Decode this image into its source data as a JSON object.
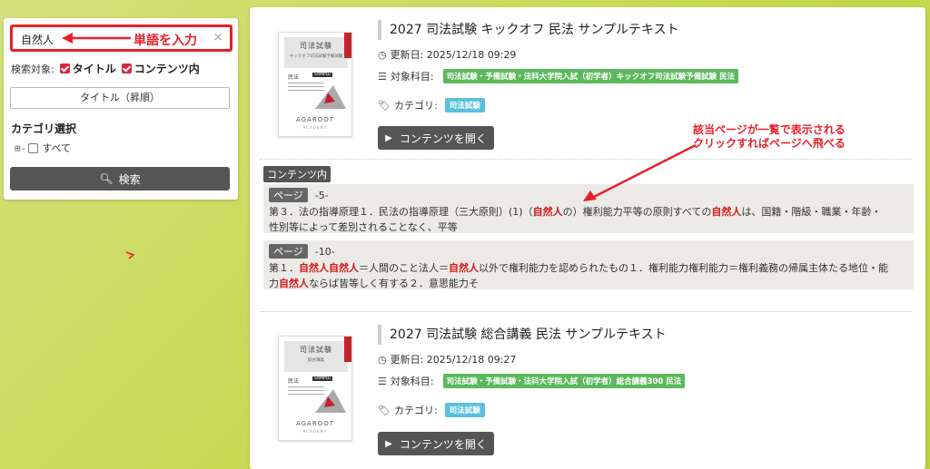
{
  "search": {
    "value": "自然人",
    "clear_icon": "×",
    "annotation": "単語を入力"
  },
  "filters": {
    "target_label": "検索対象:",
    "title_option": "タイトル",
    "contents_option": "コンテンツ内",
    "sort_value": "タイトル（昇順）",
    "category_title": "カテゴリ選択",
    "category_all": "すべて",
    "search_button": "検索"
  },
  "annotation_right": {
    "line1": "該当ページが一覧で表示される",
    "line2": "クリックすればページへ飛べる"
  },
  "items": [
    {
      "title": "2027 司法試験 キックオフ 民法 サンプルテキスト",
      "updated": "更新日: 2025/12/18 09:29",
      "subject_label": "対象科目:",
      "subject_tag": "司法試験・予備試験・法科大学院入試（初学者）キックオフ司法試験予備試験 民法",
      "category_label": "カテゴリ:",
      "category_tag": "司法試験",
      "open_button": "コンテンツを開く",
      "thumb": {
        "title": "司法試験",
        "subtitle": "キックオフ司法試験予備試験",
        "subject": "民法",
        "sample": "SAMPLE",
        "brand": "AGAROOT",
        "brand_sub": "ACADEMY"
      }
    },
    {
      "title": "2027 司法試験 総合講義 民法 サンプルテキスト",
      "updated": "更新日: 2025/12/18 09:27",
      "subject_label": "対象科目:",
      "subject_tag": "司法試験・予備試験・法科大学院入試（初学者）総合講義300 民法",
      "category_label": "カテゴリ:",
      "category_tag": "司法試験",
      "open_button": "コンテンツを開く",
      "thumb": {
        "title": "司法試験",
        "subtitle": "総合講義",
        "subject": "民法",
        "sample": "SAMPLE",
        "brand": "AGAROOT",
        "brand_sub": "ACADEMY"
      }
    }
  ],
  "contents_section": {
    "label": "コンテンツ内",
    "hits": [
      {
        "page_badge": "ページ",
        "page_no": "-5-",
        "t1": "第３．法の指導原理１．民法の指導原理（三大原則）(1)（",
        "h1": "自然人",
        "t2": "の）権利能力平等の原則すべての",
        "h2": "自然人",
        "t3": "は、国籍・階級・職業・年齢・",
        "t4": "性別等によって差別されることなく、平等"
      },
      {
        "page_badge": "ページ",
        "page_no": "-10-",
        "t1": "第１．",
        "h1": "自然人自然人",
        "t2": "＝人間のこと法人＝",
        "h2": "自然人",
        "t3": "以外で権利能力を認められたもの１．権利能力権利能力＝権利義務の帰属主体たる地位・能",
        "t4": "力",
        "h3": "自然人",
        "t5": "ならば皆等しく有する２．意思能力そ"
      }
    ]
  },
  "colors": {
    "accent_red": "#e8202a",
    "tag_green": "#5cb85c",
    "tag_blue": "#5bc0de",
    "button_dark": "#555555",
    "background_lime": "#c6d94f"
  },
  "icons": [
    "clear-icon",
    "search-icon",
    "clock-icon",
    "list-icon",
    "tag-icon",
    "play-icon",
    "tree-expand-icon"
  ]
}
